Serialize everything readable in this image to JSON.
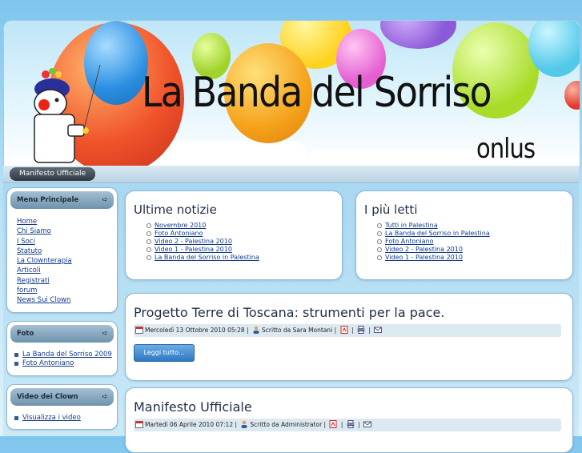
{
  "header": {
    "title": "La Banda del Sorriso",
    "subtitle": "onlus",
    "logo_icon": "clown-mascot-icon"
  },
  "topmenu": {
    "item": "Manifesto Ufficiale"
  },
  "sidebar": {
    "main_menu": {
      "title": "Menu Principale",
      "items": [
        "Home",
        "Chi Siamo",
        "I Soci",
        "Statuto",
        "La Clownterapia",
        "Articoli",
        "Registrati",
        "forum",
        "News Sui Clown"
      ]
    },
    "foto": {
      "title": "Foto",
      "items": [
        "La Banda del Sorriso 2009",
        "Foto Antoniano"
      ]
    },
    "video": {
      "title": "Video dei Clown",
      "items": [
        "Visualizza i video"
      ]
    }
  },
  "latest_news": {
    "title": "Ultime notizie",
    "items": [
      "Novembre 2010",
      "Foto Antoniano",
      "Video 2 - Palestina 2010",
      "Video 1 - Palestina 2010",
      "La Banda del Sorriso in Palestina"
    ]
  },
  "most_read": {
    "title": "I più letti",
    "items": [
      "Tutti in Palestina",
      "La Banda del Sorriso in Palestina",
      "Foto Antoniano",
      "Video 2 - Palestina 2010",
      "Video 1 - Palestina 2010"
    ]
  },
  "articles": [
    {
      "title": "Progetto Terre di Toscana: strumenti per la pace.",
      "date": "Mercoledì 13 Ottobre 2010 05:28",
      "author": "Scritto da Sara Montani",
      "read_more": "Leggi tutto..."
    },
    {
      "title": "Manifesto Ufficiale",
      "date": "Martedì 06 Aprile 2010 07:12",
      "author": "Scritto da Administrator"
    }
  ],
  "colors": {
    "link": "#123a8a",
    "module_header": "#8aaac1",
    "button": "#3a86cf"
  }
}
